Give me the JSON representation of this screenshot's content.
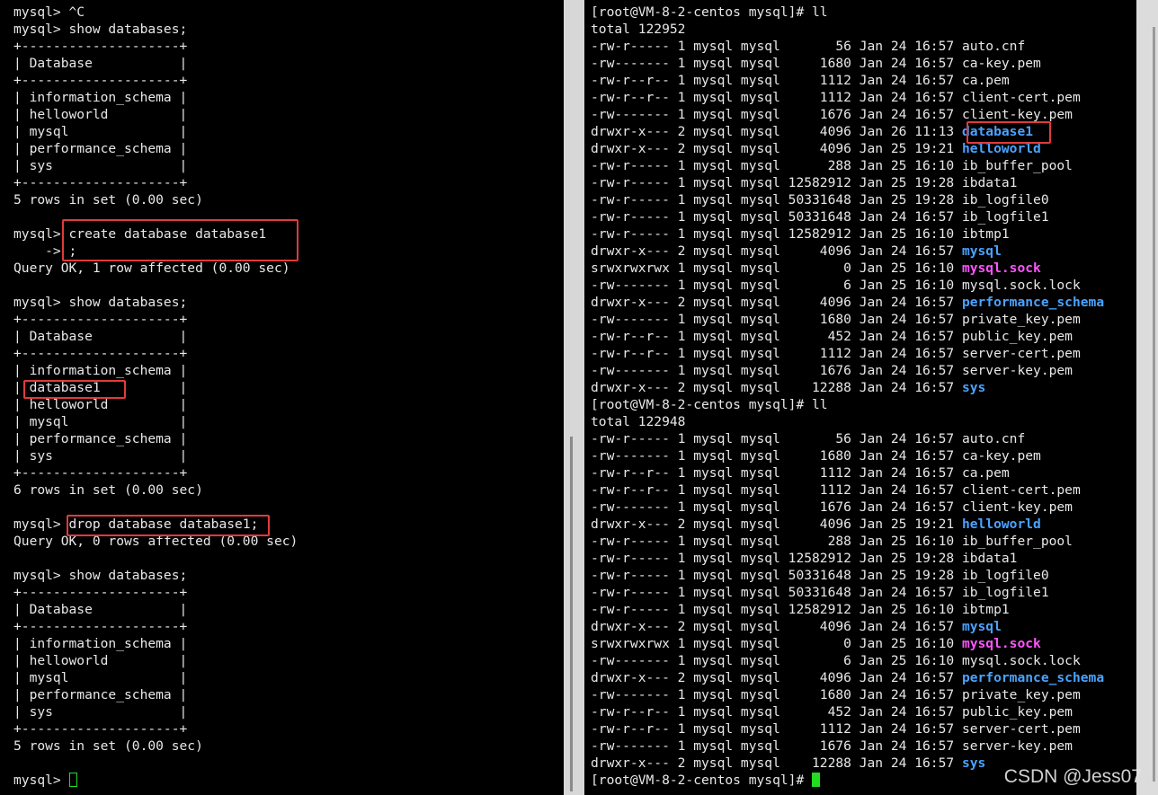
{
  "left_terminal": {
    "lines": [
      {
        "text": "mysql> ^C"
      },
      {
        "text": "mysql> show databases;"
      },
      {
        "text": "+--------------------+"
      },
      {
        "text": "| Database           |"
      },
      {
        "text": "+--------------------+"
      },
      {
        "text": "| information_schema |"
      },
      {
        "text": "| helloworld         |"
      },
      {
        "text": "| mysql              |"
      },
      {
        "text": "| performance_schema |"
      },
      {
        "text": "| sys                |"
      },
      {
        "text": "+--------------------+"
      },
      {
        "text": "5 rows in set (0.00 sec)"
      },
      {
        "text": ""
      },
      {
        "text": "mysql> create database database1"
      },
      {
        "text": "    -> ;"
      },
      {
        "text": "Query OK, 1 row affected (0.00 sec)"
      },
      {
        "text": ""
      },
      {
        "text": "mysql> show databases;"
      },
      {
        "text": "+--------------------+"
      },
      {
        "text": "| Database           |"
      },
      {
        "text": "+--------------------+"
      },
      {
        "text": "| information_schema |"
      },
      {
        "text": "| database1          |"
      },
      {
        "text": "| helloworld         |"
      },
      {
        "text": "| mysql              |"
      },
      {
        "text": "| performance_schema |"
      },
      {
        "text": "| sys                |"
      },
      {
        "text": "+--------------------+"
      },
      {
        "text": "6 rows in set (0.00 sec)"
      },
      {
        "text": ""
      },
      {
        "text": "mysql> drop database database1;"
      },
      {
        "text": "Query OK, 0 rows affected (0.00 sec)"
      },
      {
        "text": ""
      },
      {
        "text": "mysql> show databases;"
      },
      {
        "text": "+--------------------+"
      },
      {
        "text": "| Database           |"
      },
      {
        "text": "+--------------------+"
      },
      {
        "text": "| information_schema |"
      },
      {
        "text": "| helloworld         |"
      },
      {
        "text": "| mysql              |"
      },
      {
        "text": "| performance_schema |"
      },
      {
        "text": "| sys                |"
      },
      {
        "text": "+--------------------+"
      },
      {
        "text": "5 rows in set (0.00 sec)"
      },
      {
        "text": ""
      }
    ],
    "prompt": "mysql> "
  },
  "right_terminal": {
    "lines": [
      {
        "text": "[root@VM-8-2-centos mysql]# ll"
      },
      {
        "text": "total 122952"
      },
      {
        "text": "-rw-r----- 1 mysql mysql       56 Jan 24 16:57 ",
        "name": "auto.cnf"
      },
      {
        "text": "-rw------- 1 mysql mysql     1680 Jan 24 16:57 ",
        "name": "ca-key.pem"
      },
      {
        "text": "-rw-r--r-- 1 mysql mysql     1112 Jan 24 16:57 ",
        "name": "ca.pem"
      },
      {
        "text": "-rw-r--r-- 1 mysql mysql     1112 Jan 24 16:57 ",
        "name": "client-cert.pem"
      },
      {
        "text": "-rw------- 1 mysql mysql     1676 Jan 24 16:57 ",
        "name": "client-key.pem"
      },
      {
        "text": "drwxr-x--- 2 mysql mysql     4096 Jan 26 11:13 ",
        "name": "database1",
        "style": "blue"
      },
      {
        "text": "drwxr-x--- 2 mysql mysql     4096 Jan 25 19:21 ",
        "name": "helloworld",
        "style": "blue"
      },
      {
        "text": "-rw-r----- 1 mysql mysql      288 Jan 25 16:10 ",
        "name": "ib_buffer_pool"
      },
      {
        "text": "-rw-r----- 1 mysql mysql 12582912 Jan 25 19:28 ",
        "name": "ibdata1"
      },
      {
        "text": "-rw-r----- 1 mysql mysql 50331648 Jan 25 19:28 ",
        "name": "ib_logfile0"
      },
      {
        "text": "-rw-r----- 1 mysql mysql 50331648 Jan 24 16:57 ",
        "name": "ib_logfile1"
      },
      {
        "text": "-rw-r----- 1 mysql mysql 12582912 Jan 25 16:10 ",
        "name": "ibtmp1"
      },
      {
        "text": "drwxr-x--- 2 mysql mysql     4096 Jan 24 16:57 ",
        "name": "mysql",
        "style": "blue"
      },
      {
        "text": "srwxrwxrwx 1 mysql mysql        0 Jan 25 16:10 ",
        "name": "mysql.sock",
        "style": "magenta"
      },
      {
        "text": "-rw------- 1 mysql mysql        6 Jan 25 16:10 ",
        "name": "mysql.sock.lock"
      },
      {
        "text": "drwxr-x--- 2 mysql mysql     4096 Jan 24 16:57 ",
        "name": "performance_schema",
        "style": "blue"
      },
      {
        "text": "-rw------- 1 mysql mysql     1680 Jan 24 16:57 ",
        "name": "private_key.pem"
      },
      {
        "text": "-rw-r--r-- 1 mysql mysql      452 Jan 24 16:57 ",
        "name": "public_key.pem"
      },
      {
        "text": "-rw-r--r-- 1 mysql mysql     1112 Jan 24 16:57 ",
        "name": "server-cert.pem"
      },
      {
        "text": "-rw------- 1 mysql mysql     1676 Jan 24 16:57 ",
        "name": "server-key.pem"
      },
      {
        "text": "drwxr-x--- 2 mysql mysql    12288 Jan 24 16:57 ",
        "name": "sys",
        "style": "blue"
      },
      {
        "text": "[root@VM-8-2-centos mysql]# ll"
      },
      {
        "text": "total 122948"
      },
      {
        "text": "-rw-r----- 1 mysql mysql       56 Jan 24 16:57 ",
        "name": "auto.cnf"
      },
      {
        "text": "-rw------- 1 mysql mysql     1680 Jan 24 16:57 ",
        "name": "ca-key.pem"
      },
      {
        "text": "-rw-r--r-- 1 mysql mysql     1112 Jan 24 16:57 ",
        "name": "ca.pem"
      },
      {
        "text": "-rw-r--r-- 1 mysql mysql     1112 Jan 24 16:57 ",
        "name": "client-cert.pem"
      },
      {
        "text": "-rw------- 1 mysql mysql     1676 Jan 24 16:57 ",
        "name": "client-key.pem"
      },
      {
        "text": "drwxr-x--- 2 mysql mysql     4096 Jan 25 19:21 ",
        "name": "helloworld",
        "style": "blue"
      },
      {
        "text": "-rw-r----- 1 mysql mysql      288 Jan 25 16:10 ",
        "name": "ib_buffer_pool"
      },
      {
        "text": "-rw-r----- 1 mysql mysql 12582912 Jan 25 19:28 ",
        "name": "ibdata1"
      },
      {
        "text": "-rw-r----- 1 mysql mysql 50331648 Jan 25 19:28 ",
        "name": "ib_logfile0"
      },
      {
        "text": "-rw-r----- 1 mysql mysql 50331648 Jan 24 16:57 ",
        "name": "ib_logfile1"
      },
      {
        "text": "-rw-r----- 1 mysql mysql 12582912 Jan 25 16:10 ",
        "name": "ibtmp1"
      },
      {
        "text": "drwxr-x--- 2 mysql mysql     4096 Jan 24 16:57 ",
        "name": "mysql",
        "style": "blue"
      },
      {
        "text": "srwxrwxrwx 1 mysql mysql        0 Jan 25 16:10 ",
        "name": "mysql.sock",
        "style": "magenta"
      },
      {
        "text": "-rw------- 1 mysql mysql        6 Jan 25 16:10 ",
        "name": "mysql.sock.lock"
      },
      {
        "text": "drwxr-x--- 2 mysql mysql     4096 Jan 24 16:57 ",
        "name": "performance_schema",
        "style": "blue"
      },
      {
        "text": "-rw------- 1 mysql mysql     1680 Jan 24 16:57 ",
        "name": "private_key.pem"
      },
      {
        "text": "-rw-r--r-- 1 mysql mysql      452 Jan 24 16:57 ",
        "name": "public_key.pem"
      },
      {
        "text": "-rw-r--r-- 1 mysql mysql     1112 Jan 24 16:57 ",
        "name": "server-cert.pem"
      },
      {
        "text": "-rw------- 1 mysql mysql     1676 Jan 24 16:57 ",
        "name": "server-key.pem"
      },
      {
        "text": "drwxr-x--- 2 mysql mysql    12288 Jan 24 16:57 ",
        "name": "sys",
        "style": "blue"
      }
    ],
    "prompt": "[root@VM-8-2-centos mysql]# "
  },
  "watermark": "CSDN @Jess07",
  "colors": {
    "directory": "#4aa3ff",
    "socket": "#ff55ff",
    "cursor": "#22dd22",
    "highlight": "#e03b3b"
  }
}
